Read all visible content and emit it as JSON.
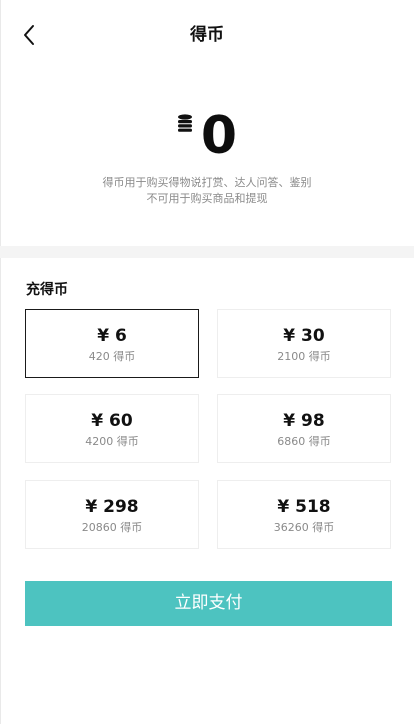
{
  "header": {
    "title": "得币",
    "back_icon": "chevron-left-icon"
  },
  "balance": {
    "value": "0",
    "icon": "coin-stack-icon"
  },
  "description": {
    "line1": "得币用于购买得物说打赏、达人问答、鉴别",
    "line2": "不可用于购买商品和提现"
  },
  "recharge": {
    "label": "充得币",
    "options": [
      {
        "price": "¥ 6",
        "coins": "420 得币",
        "selected": true
      },
      {
        "price": "¥ 30",
        "coins": "2100 得币",
        "selected": false
      },
      {
        "price": "¥ 60",
        "coins": "4200 得币",
        "selected": false
      },
      {
        "price": "¥ 98",
        "coins": "6860 得币",
        "selected": false
      },
      {
        "price": "¥ 298",
        "coins": "20860 得币",
        "selected": false
      },
      {
        "price": "¥ 518",
        "coins": "36260 得币",
        "selected": false
      }
    ]
  },
  "pay_button": {
    "label": "立即支付",
    "color": "#4dc3c0"
  }
}
